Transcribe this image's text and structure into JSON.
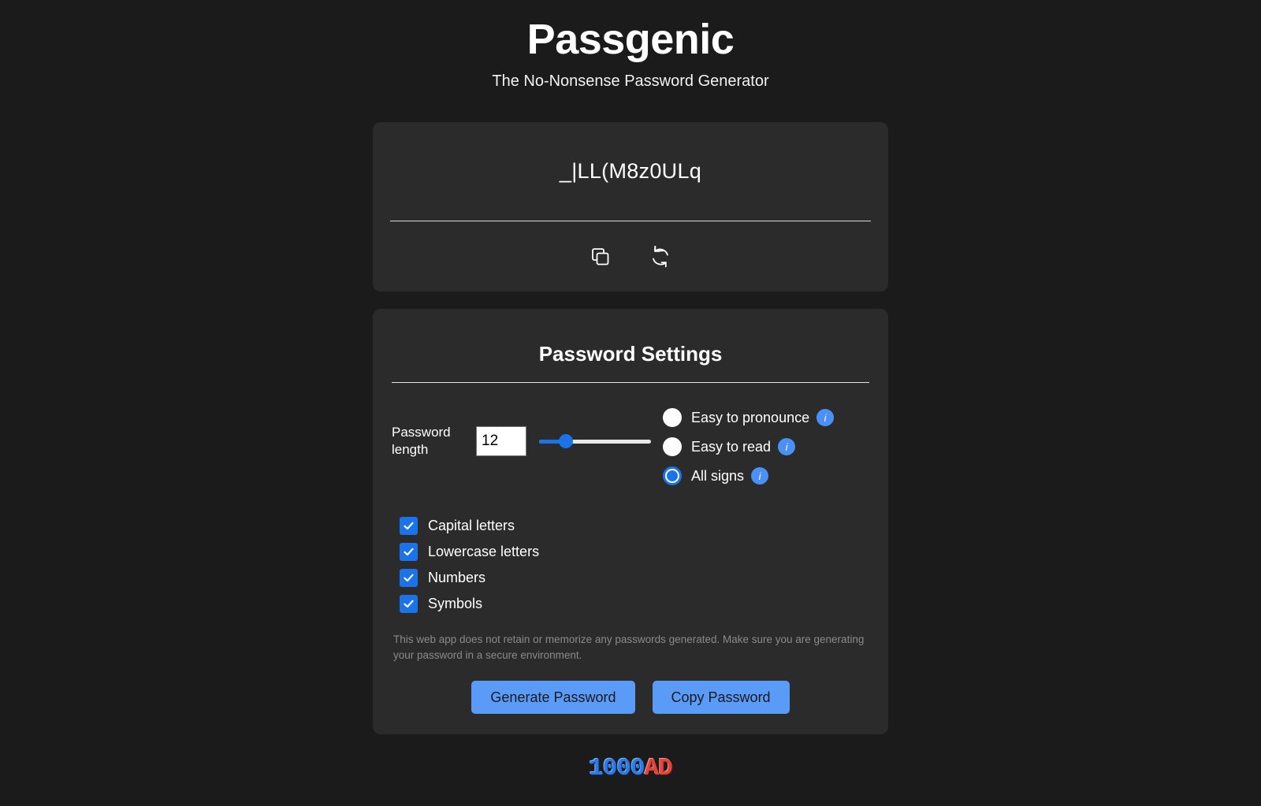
{
  "header": {
    "title": "Passgenic",
    "subtitle": "The No-Nonsense Password Generator"
  },
  "password_card": {
    "password": "_|LL(M8z0ULq",
    "copy_icon": "copy-icon",
    "refresh_icon": "refresh-icon"
  },
  "settings": {
    "title": "Password Settings",
    "length": {
      "label": "Password length",
      "value": "12",
      "slider_percent": 24
    },
    "radios": [
      {
        "label": "Easy to pronounce",
        "checked": false,
        "info": "i"
      },
      {
        "label": "Easy to read",
        "checked": false,
        "info": "i"
      },
      {
        "label": "All signs",
        "checked": true,
        "info": "i"
      }
    ],
    "checkboxes": [
      {
        "label": "Capital letters",
        "checked": true
      },
      {
        "label": "Lowercase letters",
        "checked": true
      },
      {
        "label": "Numbers",
        "checked": true
      },
      {
        "label": "Symbols",
        "checked": true
      }
    ],
    "disclaimer": "This web app does not retain or memorize any passwords generated. Make sure you are generating your password in a secure environment.",
    "generate_label": "Generate Password",
    "copy_label": "Copy Password"
  },
  "footer": {
    "logo_blue": "1000",
    "logo_red": "AD"
  },
  "colors": {
    "page_bg": "#1b1b1b",
    "card_bg": "#2b2b2b",
    "accent": "#1a73e8",
    "button_bg": "#5b9bf8",
    "info_badge": "#4a90f7",
    "muted_text": "#8a8a8a"
  }
}
